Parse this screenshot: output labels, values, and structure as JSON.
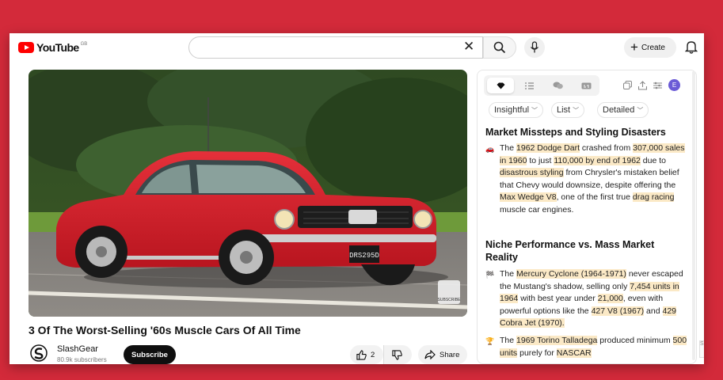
{
  "header": {
    "logo_text": "YouTube",
    "logo_region": "GB",
    "create_label": "Create"
  },
  "video": {
    "title": "3 Of The Worst-Selling '60s Muscle Cars Of All Time",
    "plate": "DRS295D",
    "watermark": "SUBSCRIBE",
    "channel_name": "SlashGear",
    "channel_subs": "80.9k subscribers",
    "subscribe_label": "Subscribe",
    "like_count": "2",
    "share_label": "Share"
  },
  "panel": {
    "avatar_letter": "E",
    "filters": [
      "Insightful",
      "List",
      "Detailed"
    ],
    "sections": [
      {
        "title": "Market Missteps and Styling Disasters",
        "items": [
          {
            "icon": "car-emoji",
            "parts": [
              {
                "t": "The "
              },
              {
                "t": "1962 Dodge Dart",
                "h": true
              },
              {
                "t": " crashed from "
              },
              {
                "t": "307,000 sales in 1960",
                "h": true
              },
              {
                "t": " to just "
              },
              {
                "t": "110,000 by end of 1962",
                "h": true
              },
              {
                "t": " due to "
              },
              {
                "t": "disastrous styling",
                "h": true
              },
              {
                "t": " from Chrysler's mistaken belief that Chevy would downsize, despite offering the "
              },
              {
                "t": "Max Wedge V8",
                "h": true
              },
              {
                "t": ", one of the first true "
              },
              {
                "t": "drag racing",
                "h": true
              },
              {
                "t": " muscle car engines."
              }
            ]
          }
        ]
      },
      {
        "title": "Niche Performance vs. Mass Market Reality",
        "items": [
          {
            "icon": "checkered-flag-emoji",
            "parts": [
              {
                "t": "The "
              },
              {
                "t": "Mercury Cyclone (1964-1971)",
                "h": true
              },
              {
                "t": " never escaped the Mustang's shadow, selling only "
              },
              {
                "t": "7,454 units in 1964",
                "h": true
              },
              {
                "t": " with best year under "
              },
              {
                "t": "21,000",
                "h": true
              },
              {
                "t": ", even with powerful options like the "
              },
              {
                "t": "427 V8 (1967)",
                "h": true
              },
              {
                "t": " and "
              },
              {
                "t": "429 Cobra Jet (1970).",
                "h": true
              }
            ]
          },
          {
            "icon": "trophy-emoji",
            "parts": [
              {
                "t": "The "
              },
              {
                "t": "1969 Torino Talladega",
                "h": true
              },
              {
                "t": " produced minimum "
              },
              {
                "t": "500 units",
                "h": true
              },
              {
                "t": " purely for "
              },
              {
                "t": "NASCAR",
                "h": true
              }
            ]
          }
        ]
      }
    ]
  },
  "colors": {
    "background": "#d32a3a",
    "highlight": "#fbe9c6",
    "car_red": "#d8202c"
  }
}
